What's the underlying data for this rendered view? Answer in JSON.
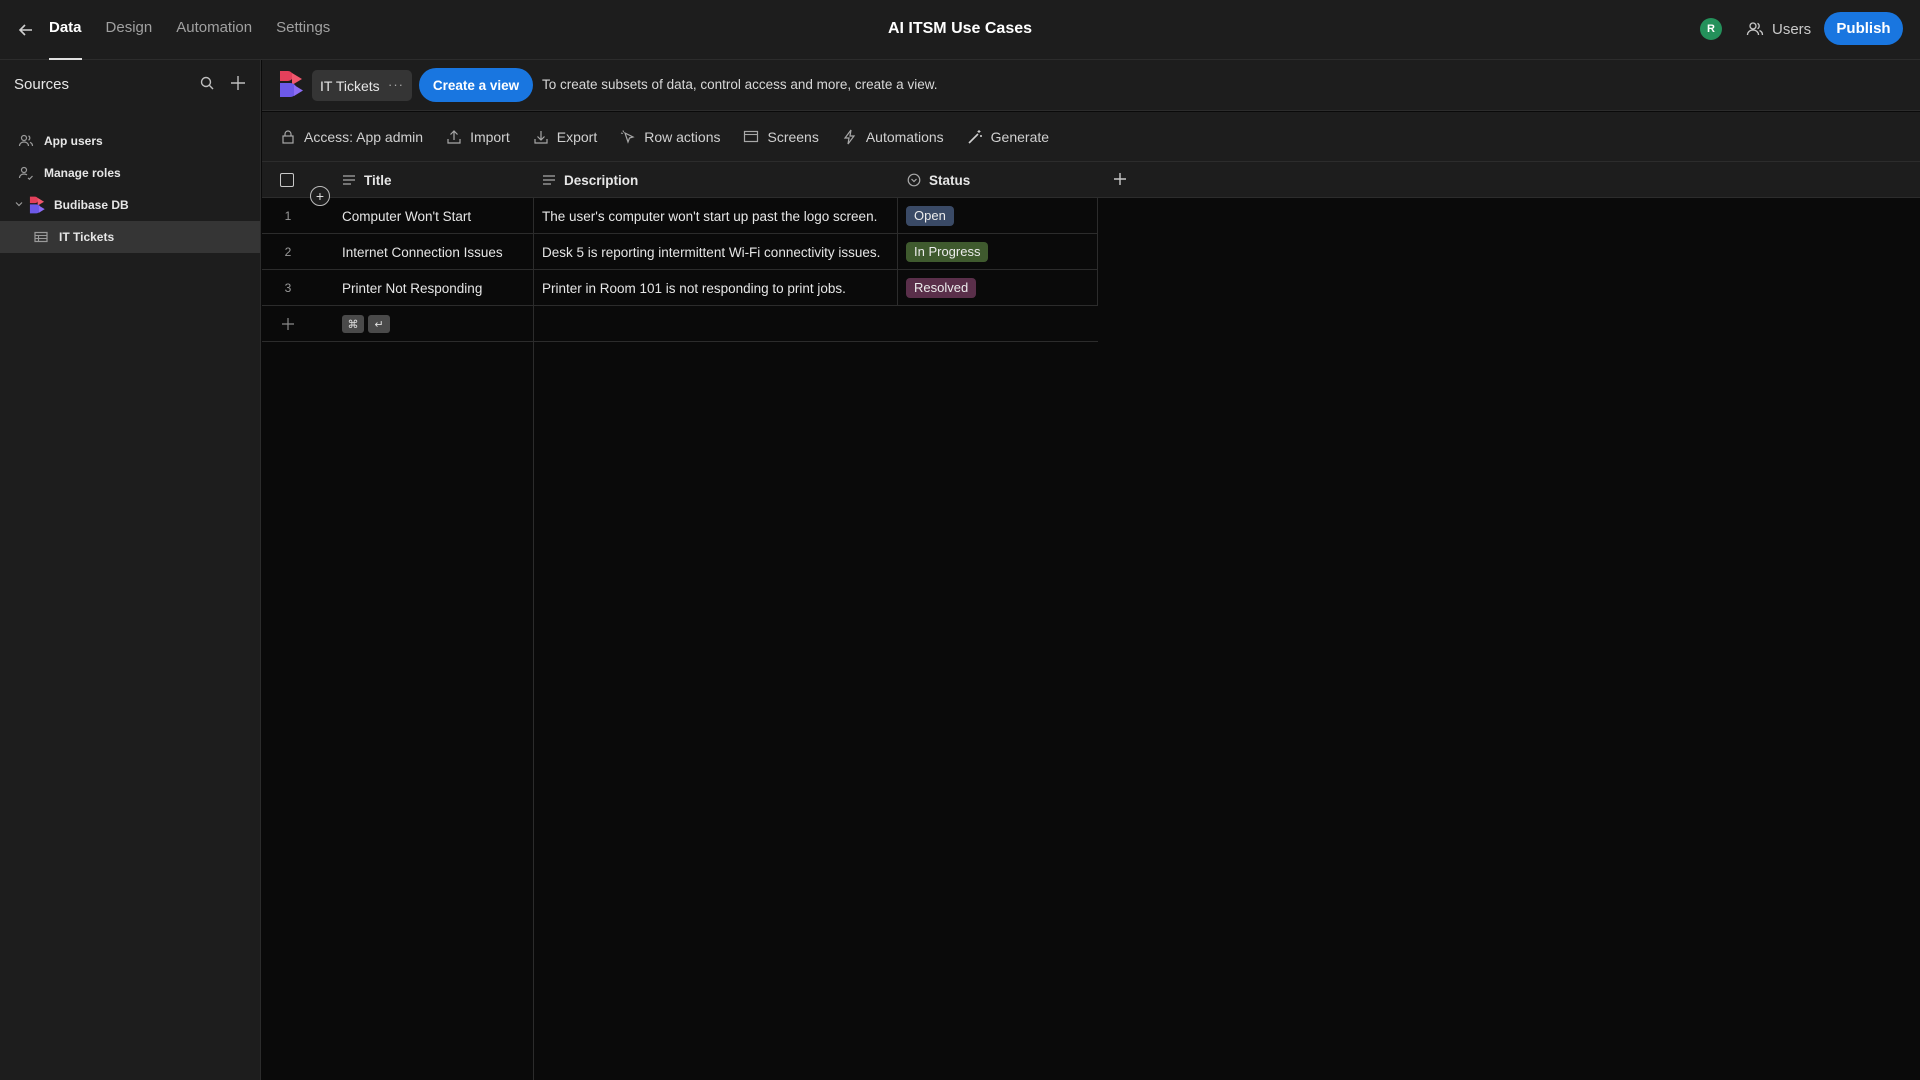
{
  "topbar": {
    "tabs": [
      {
        "label": "Data",
        "active": true
      },
      {
        "label": "Design",
        "active": false
      },
      {
        "label": "Automation",
        "active": false
      },
      {
        "label": "Settings",
        "active": false
      }
    ],
    "app_title": "AI ITSM Use Cases",
    "avatar_initial": "R",
    "users_label": "Users",
    "publish_label": "Publish"
  },
  "sidebar": {
    "title": "Sources",
    "items": [
      {
        "label": "App users",
        "icon": "users-icon"
      },
      {
        "label": "Manage roles",
        "icon": "user-roles-icon"
      },
      {
        "label": "Budibase DB",
        "icon": "budibase-logo",
        "expanded": true
      },
      {
        "label": "IT Tickets",
        "icon": "table-icon",
        "selected": true
      }
    ]
  },
  "viewbar": {
    "table_name": "IT Tickets",
    "more": "···",
    "create_view_label": "Create a view",
    "hint": "To create subsets of data, control access and more, create a view."
  },
  "actions": [
    {
      "label": "Access: App admin",
      "icon": "lock-icon"
    },
    {
      "label": "Import",
      "icon": "upload-icon"
    },
    {
      "label": "Export",
      "icon": "download-icon"
    },
    {
      "label": "Row actions",
      "icon": "cursor-icon"
    },
    {
      "label": "Screens",
      "icon": "screen-icon"
    },
    {
      "label": "Automations",
      "icon": "lightning-icon"
    },
    {
      "label": "Generate",
      "icon": "magic-wand-icon"
    }
  ],
  "table": {
    "columns": [
      {
        "label": "Title",
        "icon": "text-icon"
      },
      {
        "label": "Description",
        "icon": "text-icon"
      },
      {
        "label": "Status",
        "icon": "options-icon"
      }
    ],
    "rows": [
      {
        "num": "1",
        "title": "Computer Won't Start",
        "description": "The user's computer won't start up past the logo screen.",
        "status": "Open",
        "status_color": "#3a4a66"
      },
      {
        "num": "2",
        "title": "Internet Connection Issues",
        "description": "Desk 5 is reporting intermittent Wi-Fi connectivity issues.",
        "status": "In Progress",
        "status_color": "#3f5a2e"
      },
      {
        "num": "3",
        "title": "Printer Not Responding",
        "description": "Printer in Room 101 is not responding to print jobs.",
        "status": "Resolved",
        "status_color": "#5a2f4a"
      }
    ],
    "new_row_shortcut": [
      "⌘",
      "↵"
    ]
  },
  "colors": {
    "accent": "#1976e0",
    "avatar": "#24915b"
  }
}
